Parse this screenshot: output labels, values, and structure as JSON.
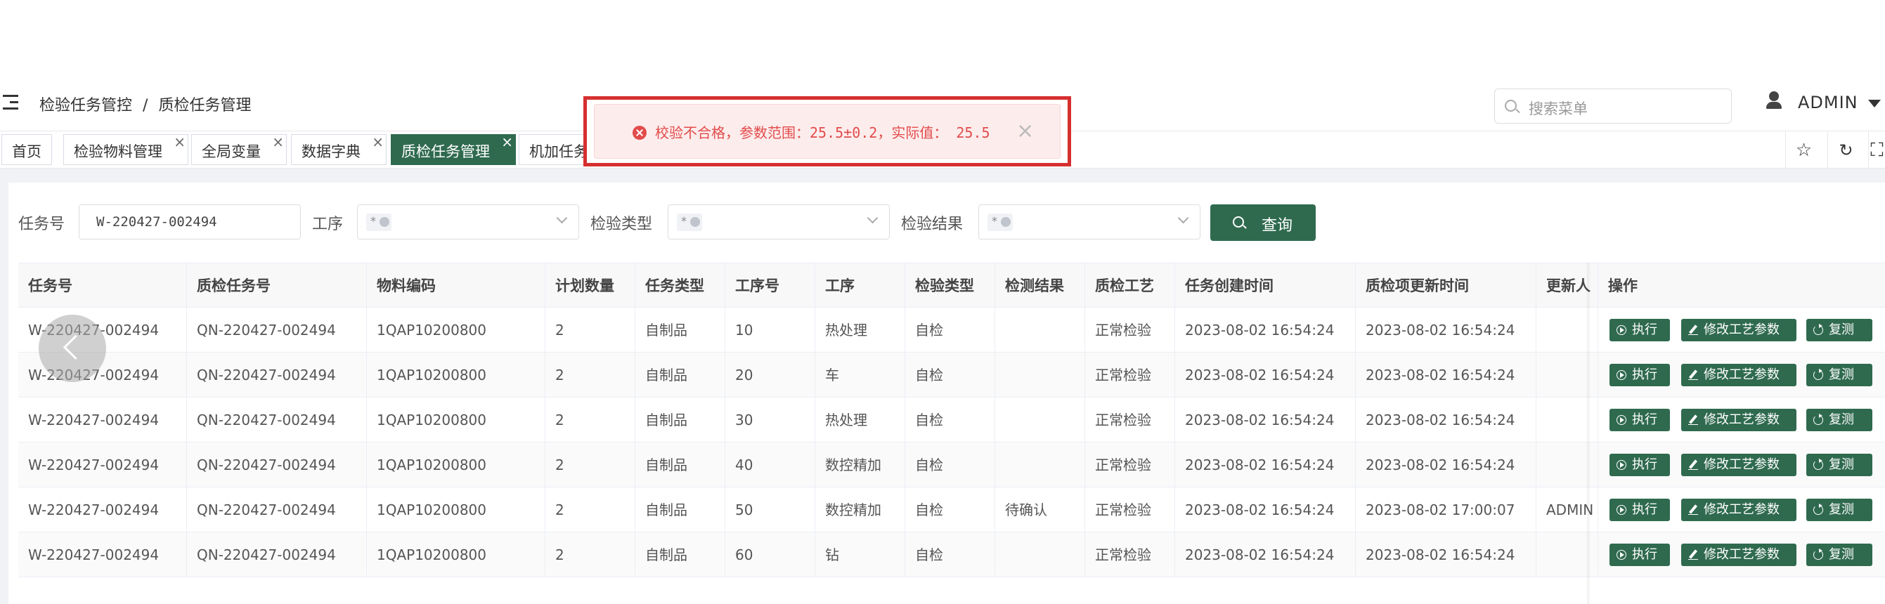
{
  "header": {
    "breadcrumb": [
      "检验任务管控",
      "/",
      "质检任务管理"
    ],
    "search_placeholder": "搜索菜单",
    "user_name": "ADMIN"
  },
  "tabs": [
    {
      "label": "首页",
      "closable": false,
      "active": false
    },
    {
      "label": "检验物料管理",
      "closable": true,
      "active": false
    },
    {
      "label": "全局变量",
      "closable": true,
      "active": false
    },
    {
      "label": "数据字典",
      "closable": true,
      "active": false
    },
    {
      "label": "质检任务管理",
      "closable": true,
      "active": true
    },
    {
      "label": "机加任务管理",
      "closable": false,
      "active": false
    }
  ],
  "toolbar_icons": [
    "star-icon",
    "refresh-icon",
    "fullscreen-icon"
  ],
  "filters": {
    "task_no_label": "任务号",
    "task_no_value": "W-220427-002494",
    "process_label": "工序",
    "inspect_type_label": "检验类型",
    "inspect_result_label": "检验结果",
    "tag_star": "*",
    "query_label": "查询"
  },
  "table": {
    "columns": [
      "任务号",
      "质检任务号",
      "物料编码",
      "计划数量",
      "任务类型",
      "工序号",
      "工序",
      "检验类型",
      "检测结果",
      "质检工艺",
      "任务创建时间",
      "质检项更新时间",
      "更新人",
      "操作"
    ],
    "rows": [
      [
        "W-220427-002494",
        "QN-220427-002494",
        "1QAP10200800",
        "2",
        "自制品",
        "10",
        "热处理",
        "自检",
        "",
        "正常检验",
        "2023-08-02 16:54:24",
        "2023-08-02 16:54:24",
        ""
      ],
      [
        "W-220427-002494",
        "QN-220427-002494",
        "1QAP10200800",
        "2",
        "自制品",
        "20",
        "车",
        "自检",
        "",
        "正常检验",
        "2023-08-02 16:54:24",
        "2023-08-02 16:54:24",
        ""
      ],
      [
        "W-220427-002494",
        "QN-220427-002494",
        "1QAP10200800",
        "2",
        "自制品",
        "30",
        "热处理",
        "自检",
        "",
        "正常检验",
        "2023-08-02 16:54:24",
        "2023-08-02 16:54:24",
        ""
      ],
      [
        "W-220427-002494",
        "QN-220427-002494",
        "1QAP10200800",
        "2",
        "自制品",
        "40",
        "数控精加",
        "自检",
        "",
        "正常检验",
        "2023-08-02 16:54:24",
        "2023-08-02 16:54:24",
        ""
      ],
      [
        "W-220427-002494",
        "QN-220427-002494",
        "1QAP10200800",
        "2",
        "自制品",
        "50",
        "数控精加",
        "自检",
        "待确认",
        "正常检验",
        "2023-08-02 16:54:24",
        "2023-08-02 17:00:07",
        "ADMIN"
      ],
      [
        "W-220427-002494",
        "QN-220427-002494",
        "1QAP10200800",
        "2",
        "自制品",
        "60",
        "钻",
        "自检",
        "",
        "正常检验",
        "2023-08-02 16:54:24",
        "2023-08-02 16:54:24",
        ""
      ]
    ],
    "actions": [
      "执行",
      "修改工艺参数",
      "复测"
    ]
  },
  "toast": {
    "message": "校验不合格，参数范围：25.5±0.2，实际值： 25.5",
    "close": "×"
  },
  "colors": {
    "primary": "#2f6a4f",
    "error": "#e24b4b",
    "highlight_border": "#d62f2f"
  }
}
